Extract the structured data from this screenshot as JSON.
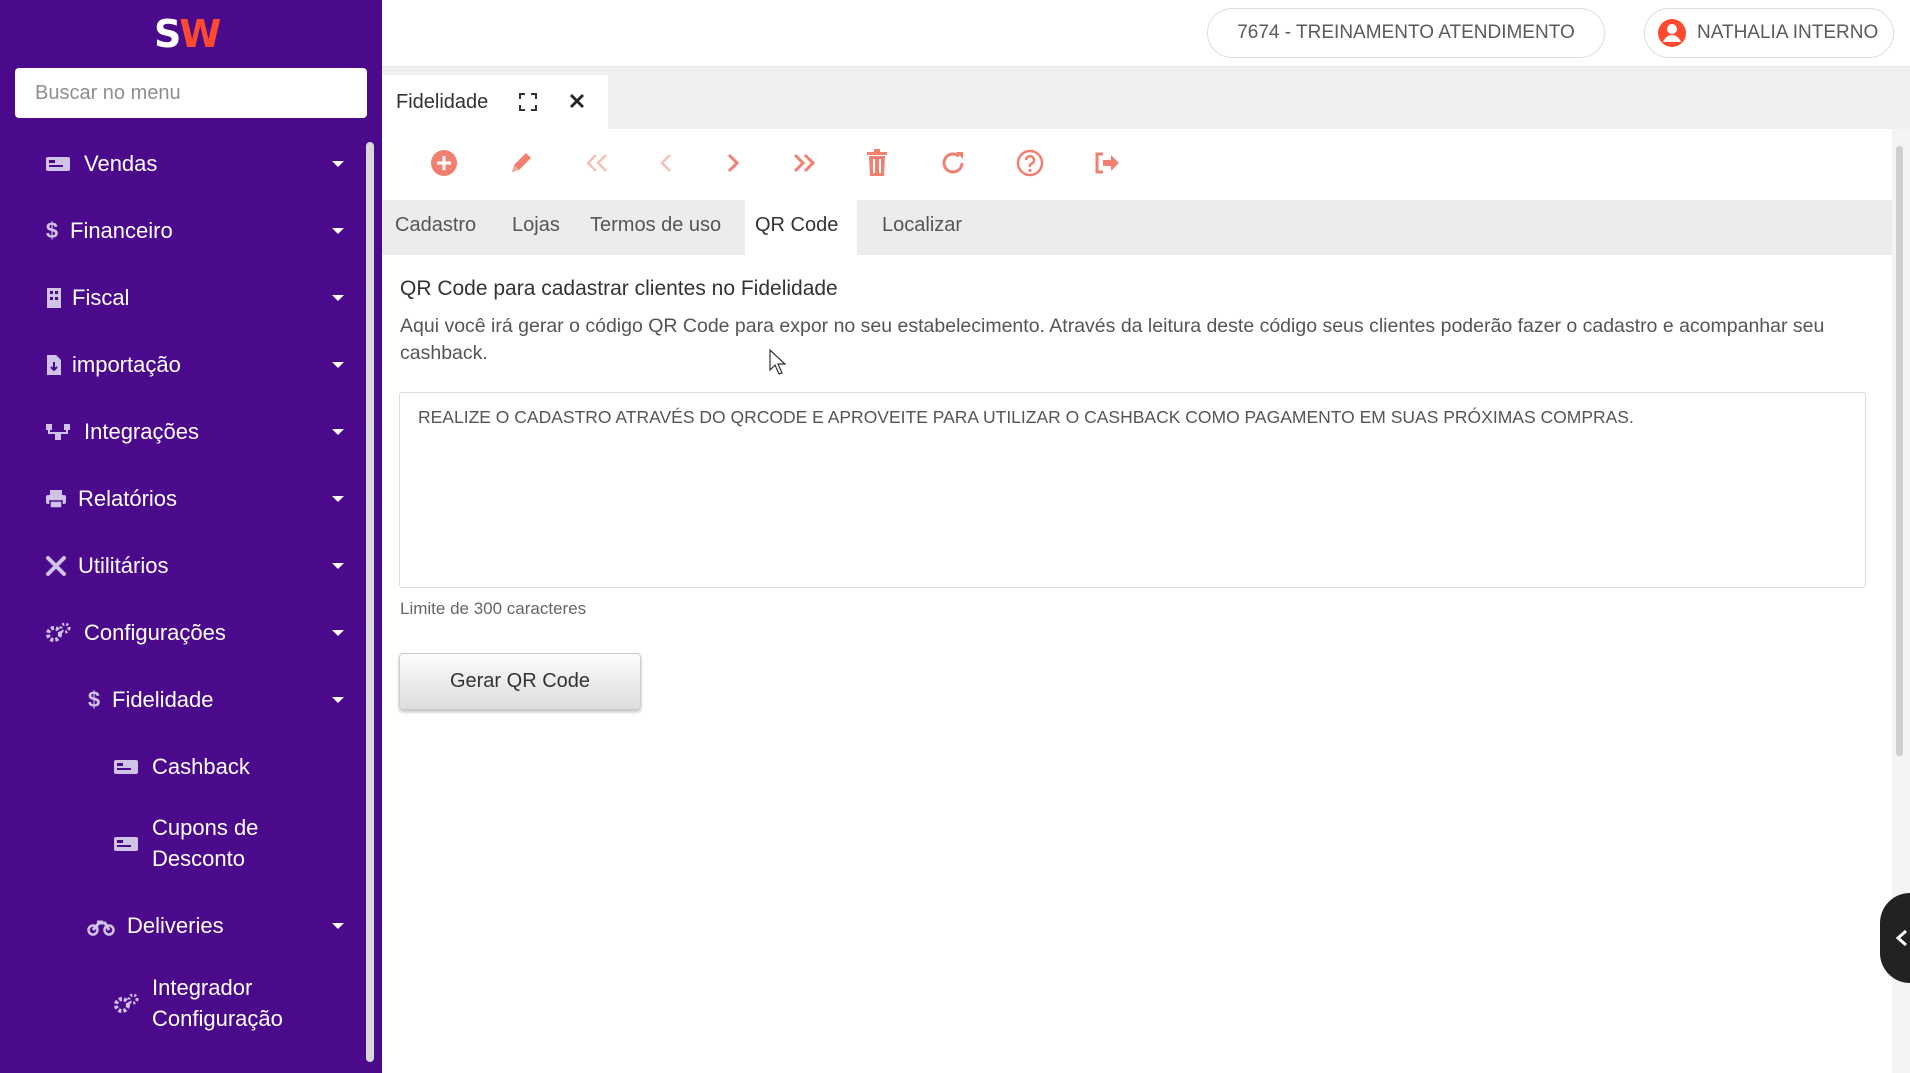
{
  "app": {
    "logo_s": "S",
    "logo_w": "W"
  },
  "search": {
    "placeholder": "Buscar no menu"
  },
  "sidebar": {
    "items": [
      {
        "label": "Vendas",
        "icon": "money-bill-icon"
      },
      {
        "label": "Financeiro",
        "icon": "dollar-icon"
      },
      {
        "label": "Fiscal",
        "icon": "building-icon"
      },
      {
        "label": "importação",
        "icon": "file-import-icon"
      },
      {
        "label": "Integrações",
        "icon": "network-icon"
      },
      {
        "label": "Relatórios",
        "icon": "print-icon"
      },
      {
        "label": "Utilitários",
        "icon": "tools-icon"
      },
      {
        "label": "Configurações",
        "icon": "cogs-icon"
      },
      {
        "label": "Fidelidade",
        "icon": "dollar-icon"
      },
      {
        "label": "Cashback",
        "icon": "money-bill-icon"
      },
      {
        "label_line1": "Cupons de",
        "label_line2": "Desconto",
        "icon": "money-bill-icon"
      },
      {
        "label": "Deliveries",
        "icon": "motorcycle-icon"
      },
      {
        "label_line1": "Integrador",
        "label_line2": "Configuração",
        "icon": "cogs-icon"
      }
    ]
  },
  "header": {
    "company": "7674 - TREINAMENTO ATENDIMENTO",
    "user": "NATHALIA INTERNO"
  },
  "doc_tab": {
    "label": "Fidelidade"
  },
  "toolbar": {
    "icons": [
      "add-icon",
      "edit-icon",
      "first-icon",
      "previous-icon",
      "next-icon",
      "last-icon",
      "delete-icon",
      "refresh-icon",
      "help-icon",
      "exit-icon"
    ],
    "color": "#f08070"
  },
  "subtabs": [
    "Cadastro",
    "Lojas",
    "Termos de uso",
    "QR Code",
    "Localizar"
  ],
  "active_subtab": "QR Code",
  "main": {
    "heading": "QR Code para cadastrar clientes no Fidelidade",
    "description": "Aqui você irá gerar o código QR Code para expor no seu estabelecimento. Através da leitura deste código seus clientes poderão fazer o cadastro e acompanhar seu cashback.",
    "message": "REALIZE O CADASTRO ATRAVÉS DO QRCODE E APROVEITE PARA UTILIZAR O CASHBACK COMO PAGAMENTO EM SUAS PRÓXIMAS COMPRAS.",
    "limit": "Limite de 300 caracteres",
    "button": "Gerar QR Code"
  },
  "colors": {
    "sidebar": "#4b0a8c",
    "accent": "#ff4a2f",
    "toolbar_icons": "#f08070"
  }
}
